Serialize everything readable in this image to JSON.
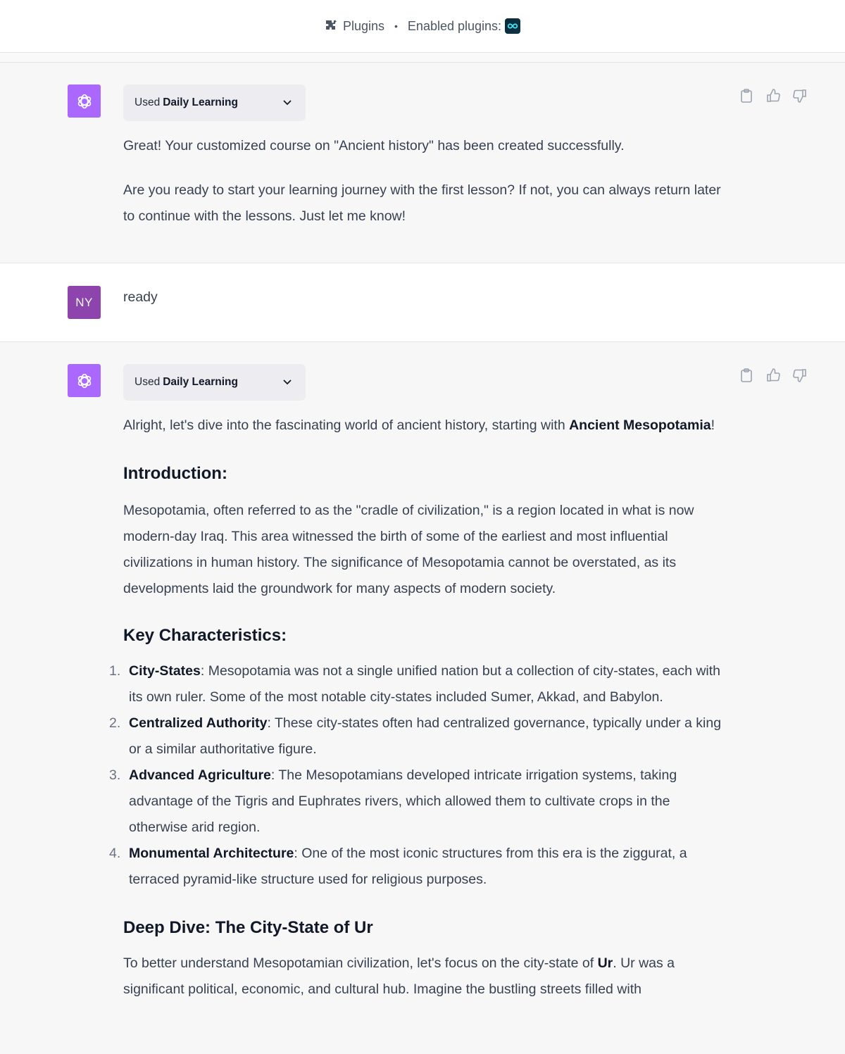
{
  "topbar": {
    "plugins_label": "Plugins",
    "separator": "•",
    "enabled_label": "Enabled plugins:",
    "enabled_plugin_icon": "daily-learning-infinity-icon"
  },
  "messages": [
    {
      "role": "assistant",
      "avatar_icon": "openai-logo-icon",
      "tool": {
        "used_label": "Used",
        "plugin_name": "Daily Learning"
      },
      "actions": [
        "clipboard-icon",
        "thumbs-up-icon",
        "thumbs-down-icon"
      ],
      "paragraphs": [
        "Great! Your customized course on \"Ancient history\" has been created successfully.",
        "Are you ready to start your learning journey with the first lesson? If not, you can always return later to continue with the lessons. Just let me know!"
      ]
    },
    {
      "role": "user",
      "avatar_initials": "NY",
      "text": "ready"
    },
    {
      "role": "assistant",
      "avatar_icon": "openai-logo-icon",
      "tool": {
        "used_label": "Used",
        "plugin_name": "Daily Learning"
      },
      "actions": [
        "clipboard-icon",
        "thumbs-up-icon",
        "thumbs-down-icon"
      ],
      "intro": {
        "before": "Alright, let's dive into the fascinating world of ancient history, starting with ",
        "bold": "Ancient Mesopotamia",
        "after": "!"
      },
      "sections": {
        "introduction": {
          "heading": "Introduction:",
          "text": "Mesopotamia, often referred to as the \"cradle of civilization,\" is a region located in what is now modern-day Iraq. This area witnessed the birth of some of the earliest and most influential civilizations in human history. The significance of Mesopotamia cannot be overstated, as its developments laid the groundwork for many aspects of modern society."
        },
        "key_characteristics": {
          "heading": "Key Characteristics:",
          "items": [
            {
              "num": "1.",
              "title": "City-States",
              "text": ": Mesopotamia was not a single unified nation but a collection of city-states, each with its own ruler. Some of the most notable city-states included Sumer, Akkad, and Babylon."
            },
            {
              "num": "2.",
              "title": "Centralized Authority",
              "text": ": These city-states often had centralized governance, typically under a king or a similar authoritative figure."
            },
            {
              "num": "3.",
              "title": "Advanced Agriculture",
              "text": ": The Mesopotamians developed intricate irrigation systems, taking advantage of the Tigris and Euphrates rivers, which allowed them to cultivate crops in the otherwise arid region."
            },
            {
              "num": "4.",
              "title": "Monumental Architecture",
              "text": ": One of the most iconic structures from this era is the ziggurat, a terraced pyramid-like structure used for religious purposes."
            }
          ]
        },
        "deep_dive": {
          "heading": "Deep Dive: The City-State of Ur",
          "before": "To better understand Mesopotamian civilization, let's focus on the city-state of ",
          "bold": "Ur",
          "after": ". Ur was a significant political, economic, and cultural hub. Imagine the bustling streets filled with"
        }
      }
    }
  ],
  "colors": {
    "assistant_avatar": "#ab68ff",
    "user_avatar": "#8e44ad",
    "tool_pill_bg": "#ececf1",
    "assistant_bg": "#f7f7f8",
    "user_bg": "#ffffff"
  }
}
